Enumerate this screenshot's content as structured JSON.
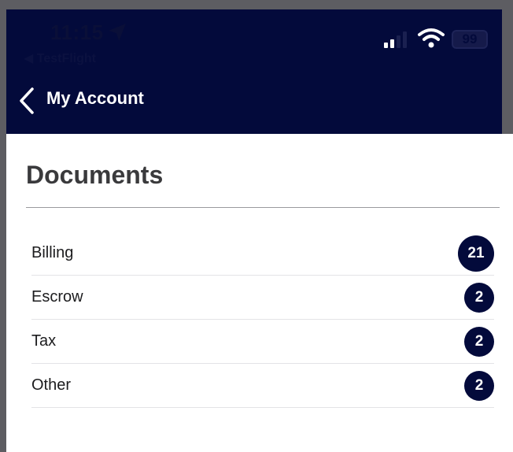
{
  "status_bar": {
    "time": "11:15",
    "back_app": "◀ TestFlight",
    "battery": "99"
  },
  "nav": {
    "title": "My Account"
  },
  "section": {
    "title": "Documents"
  },
  "documents": [
    {
      "label": "Billing",
      "count": "21"
    },
    {
      "label": "Escrow",
      "count": "2"
    },
    {
      "label": "Tax",
      "count": "2"
    },
    {
      "label": "Other",
      "count": "2"
    }
  ],
  "colors": {
    "brand_navy": "#030a3b",
    "frame_gray": "#5d5d62"
  }
}
